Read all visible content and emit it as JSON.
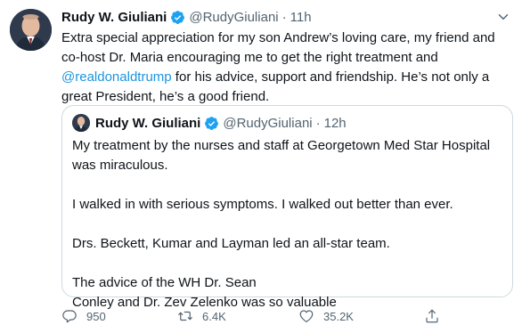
{
  "tweet": {
    "author_name": "Rudy W. Giuliani",
    "handle": "@RudyGiuliani",
    "separator": "·",
    "time": "11h",
    "text_before": "Extra special appreciation for my son Andrew’s loving care, my friend and co-host Dr. Maria encouraging  me to get the right treatment and ",
    "mention": "@realdonaldtrump",
    "text_after": " for his advice, support and friendship. He’s not only a great President, he’s a good friend."
  },
  "quoted_tweet": {
    "author_name": "Rudy W. Giuliani",
    "handle": "@RudyGiuliani",
    "separator": "·",
    "time": "12h",
    "paragraphs": [
      "My treatment by the nurses and staff at Georgetown Med Star Hospital was miraculous.",
      "I walked in with serious symptoms. I walked out better than ever.",
      "Drs. Beckett, Kumar and Layman led  an all-star team.",
      "The advice of the WH Dr. Sean\nConley and Dr. Zev Zelenko was so valuable"
    ]
  },
  "actions": {
    "replies": "950",
    "retweets": "6.4K",
    "likes": "35.2K"
  },
  "icons": {
    "verified": "verified-badge-icon",
    "caret": "chevron-down-icon",
    "reply": "reply-icon",
    "retweet": "retweet-icon",
    "like": "heart-icon",
    "share": "share-icon"
  },
  "colors": {
    "accent": "#1da1f2",
    "link": "#1b95e0",
    "secondary_text": "#536471",
    "border": "#cfd9de"
  }
}
